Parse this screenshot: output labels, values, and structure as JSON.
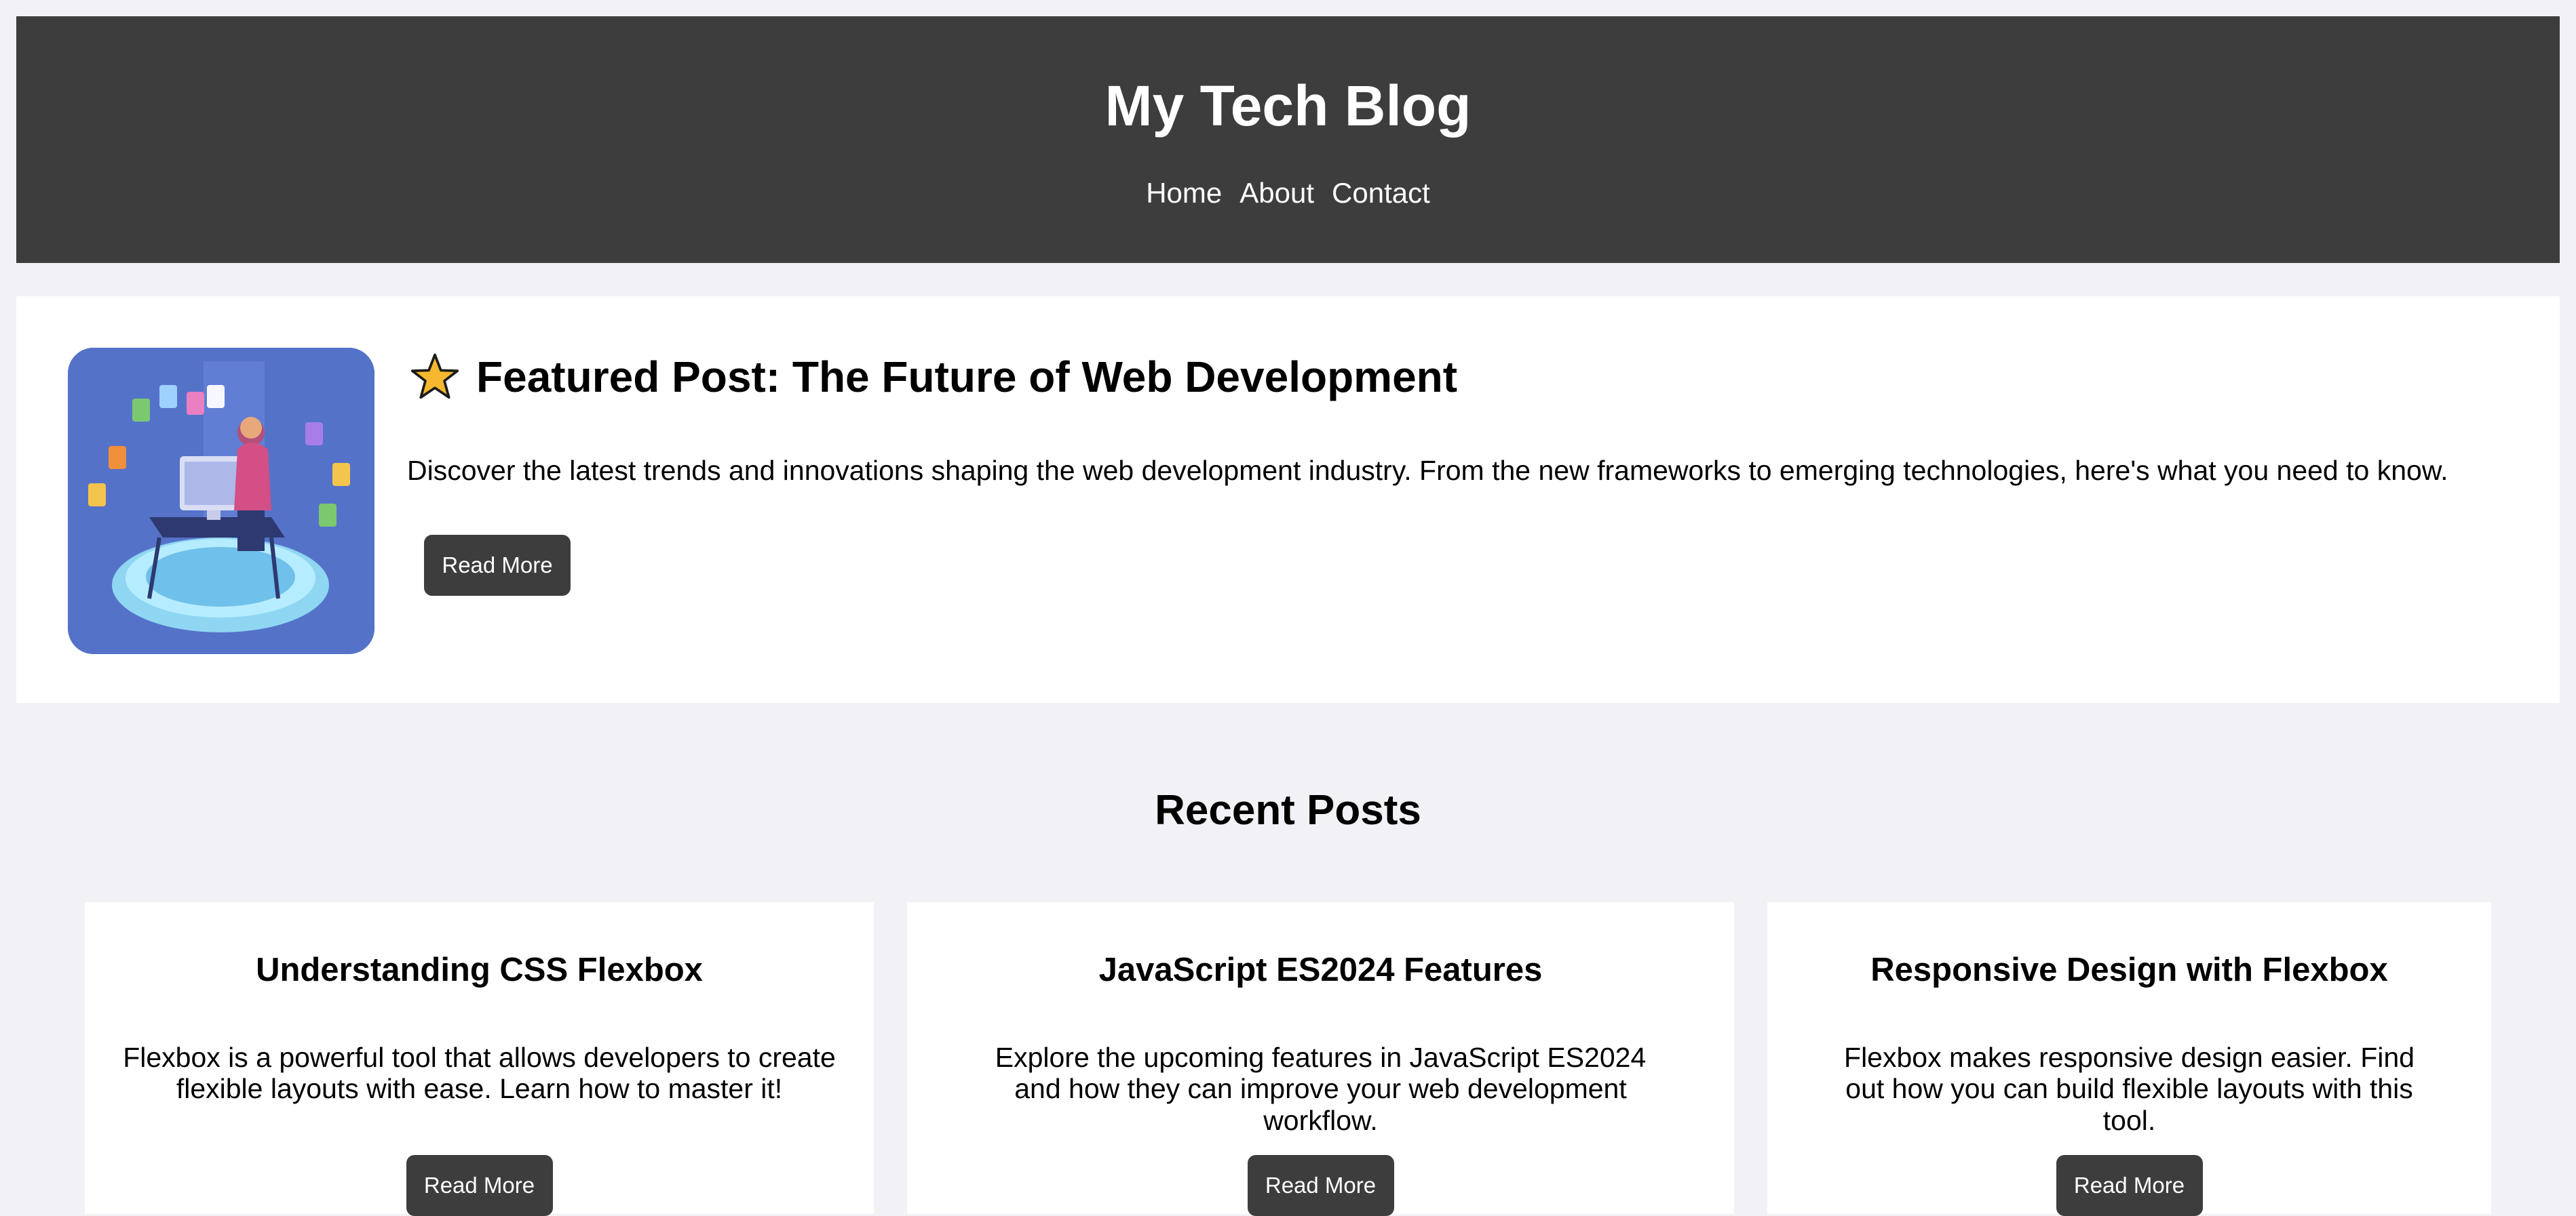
{
  "header": {
    "title": "My Tech Blog",
    "nav": [
      "Home",
      "About",
      "Contact"
    ]
  },
  "featured": {
    "icon": "star-icon",
    "title": "Featured Post: The Future of Web Development",
    "description": "Discover the latest trends and innovations shaping the web development industry. From the new frameworks to emerging technologies, here's what you need to know.",
    "button_label": "Read More"
  },
  "recent": {
    "title": "Recent Posts",
    "posts": [
      {
        "title": "Understanding CSS Flexbox",
        "description": "Flexbox is a powerful tool that allows developers to create flexible layouts with ease. Learn how to master it!",
        "button_label": "Read More"
      },
      {
        "title": "JavaScript ES2024 Features",
        "description": "Explore the upcoming features in JavaScript ES2024 and how they can improve your web development workflow.",
        "button_label": "Read More"
      },
      {
        "title": "Responsive Design with Flexbox",
        "description": "Flexbox makes responsive design easier. Find out how you can build flexible layouts with this tool.",
        "button_label": "Read More"
      }
    ]
  },
  "colors": {
    "header_bg": "#3d3d3d",
    "page_bg": "#f2f2f6",
    "button_bg": "#3d3d3d",
    "image_bg": "#5572c9",
    "star": "#f5b82e"
  }
}
